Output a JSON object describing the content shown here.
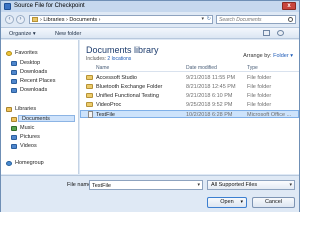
{
  "window": {
    "title": "Source File for Checkpoint",
    "close_label": "x"
  },
  "address": {
    "crumbs": "› Libraries › Documents ›",
    "search_placeholder": "Search Documents"
  },
  "toolbar": {
    "organize_label": "Organize ▾",
    "new_folder_label": "New folder"
  },
  "sidebar": {
    "favorites": "Favorites",
    "desktop": "Desktop",
    "downloads": "Downloads",
    "recent_places": "Recent Places",
    "downloads2": "Downloads",
    "libraries": "Libraries",
    "documents": "Documents",
    "music": "Music",
    "pictures": "Pictures",
    "videos": "Videos",
    "homegroup": "Homegroup"
  },
  "main": {
    "library_title": "Documents library",
    "includes_prefix": "Includes: ",
    "includes_link": "2 locations",
    "arrange_label": "Arrange by:",
    "arrange_value": "Folder ▾",
    "columns": {
      "name": "Name",
      "date": "Date modified",
      "type": "Type"
    },
    "files": [
      {
        "name": "Accessoft Studio",
        "date": "9/21/2018 11:55 PM",
        "type": "File folder"
      },
      {
        "name": "Bluetooth Exchange Folder",
        "date": "8/21/2018 12:45 PM",
        "type": "File folder"
      },
      {
        "name": "Unified Functional Testing",
        "date": "9/21/2018 6:10 PM",
        "type": "File folder"
      },
      {
        "name": "VideoProc",
        "date": "9/25/2018 9:52 PM",
        "type": "File folder"
      },
      {
        "name": "TestFile",
        "date": "10/2/2018 6:28 PM",
        "type": "Microsoft Office ..."
      }
    ]
  },
  "bottom": {
    "filename_label": "File name:",
    "filename_value": "TestFile",
    "filter_value": "All Supported Files",
    "open_label": "Open",
    "cancel_label": "Cancel"
  }
}
